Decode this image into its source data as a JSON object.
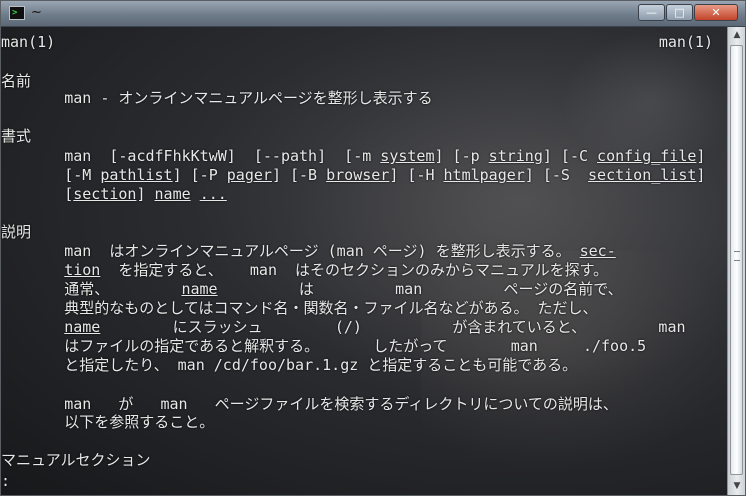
{
  "window": {
    "title": "~",
    "icon": "mintty-terminal-icon",
    "prompt_glyph": ">",
    "controls": {
      "minimize": "—",
      "maximize": "□",
      "close": "✕"
    }
  },
  "terminal": {
    "header_left": "man(1)",
    "header_right": "man(1)",
    "lines": [
      [
        "名前"
      ],
      [
        "       man - オンラインマニュアルページを整形し表示する"
      ],
      [
        "書式"
      ],
      [
        "       man  [-acdfFhkKtwW]  [--path]  [-m ",
        {
          "u": "system"
        },
        "] [-p ",
        {
          "u": "string"
        },
        "] [-C ",
        {
          "u": "config_file"
        },
        "]"
      ],
      [
        "       [-M ",
        {
          "u": "pathlist"
        },
        "] [-P ",
        {
          "u": "pager"
        },
        "] [-B ",
        {
          "u": "browser"
        },
        "] [-H ",
        {
          "u": "htmlpager"
        },
        "] [-S  ",
        {
          "u": "section_list"
        },
        "]"
      ],
      [
        "       [",
        {
          "u": "section"
        },
        "] ",
        {
          "u": "name"
        },
        " ",
        {
          "u": "..."
        }
      ],
      [
        "説明"
      ],
      [
        "       man  はオンラインマニュアルページ (man ページ) を整形し表示する。 ",
        {
          "u": "sec-"
        }
      ],
      [
        "       ",
        {
          "u": "tion"
        },
        "  を指定すると、   man  はそのセクションのみからマニュアルを探す。"
      ],
      [
        "       通常、        ",
        {
          "u": "name"
        },
        "         は         man         ページの名前で、"
      ],
      [
        "       典型的なものとしてはコマンド名・関数名・ファイル名などがある。 ただし、"
      ],
      [
        "       ",
        {
          "u": "name"
        },
        "        にスラッシュ        (/)          が含まれていると、        man"
      ],
      [
        "       はファイルの指定であると解釈する。      したがって       man     ./foo.5"
      ],
      [
        "       と指定したり、 man /cd/foo/bar.1.gz と指定することも可能である。"
      ],
      [
        "       man   が   man   ページファイルを検索するディレクトリについての説明は、"
      ],
      [
        "       以下を参照すること。"
      ],
      [
        "マニュアルセクション"
      ],
      [
        ":"
      ]
    ]
  },
  "scrollbar": {
    "up_icon": "▲",
    "down_icon": "▼"
  }
}
